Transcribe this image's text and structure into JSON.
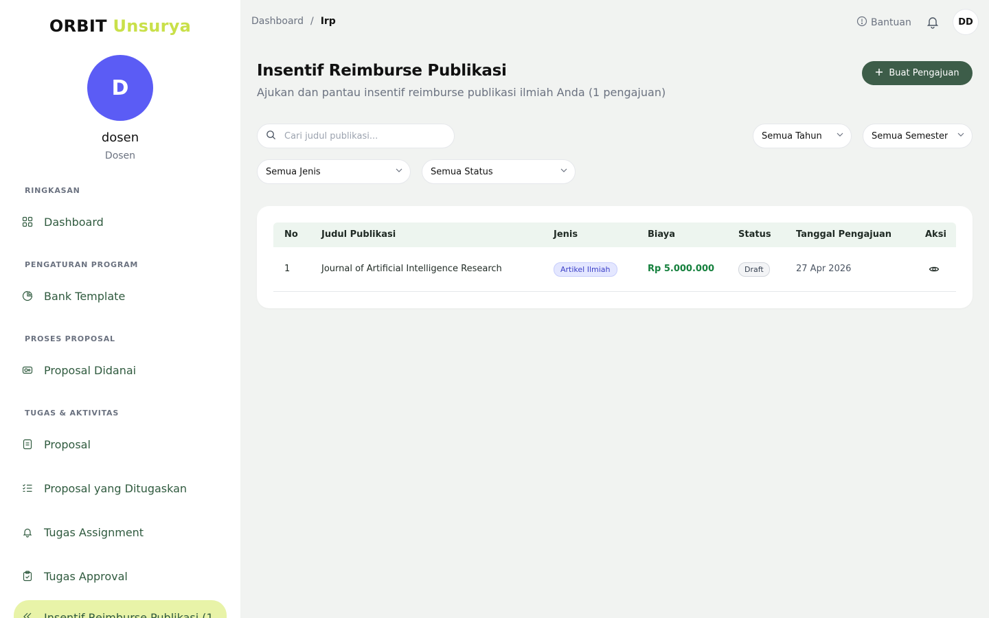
{
  "sidebar": {
    "brand_primary": "ORBIT",
    "brand_secondary": "Unsurya",
    "avatar_letter": "D",
    "user_name": "dosen",
    "user_role": "Dosen",
    "sections": {
      "ringkasan": "RINGKASAN",
      "pengaturan": "PENGATURAN PROGRAM",
      "proses": "PROSES PROPOSAL",
      "tugas": "TUGAS & AKTIVITAS"
    },
    "items": {
      "dashboard": "Dashboard",
      "bank_template": "Bank Template",
      "proposal_didanai": "Proposal Didanai",
      "proposal": "Proposal",
      "proposal_ditugaskan": "Proposal yang Ditugaskan",
      "tugas_assignment": "Tugas Assignment",
      "tugas_approval": "Tugas Approval",
      "insentif": "Insentif Reimburse Publikasi (1"
    }
  },
  "topbar": {
    "breadcrumb_root": "Dashboard",
    "breadcrumb_sep": "/",
    "breadcrumb_current": "Irp",
    "help_label": "Bantuan",
    "user_initials": "DD"
  },
  "header": {
    "title": "Insentif Reimburse Publikasi",
    "subtitle": "Ajukan dan pantau insentif reimburse publikasi ilmiah Anda (1 pengajuan)",
    "create_button": "Buat Pengajuan"
  },
  "filters": {
    "search_placeholder": "Cari judul publikasi...",
    "tahun": "Semua Tahun",
    "semester": "Semua Semester",
    "jenis": "Semua Jenis",
    "status": "Semua Status"
  },
  "table": {
    "headers": {
      "no": "No",
      "judul": "Judul Publikasi",
      "jenis": "Jenis",
      "biaya": "Biaya",
      "status": "Status",
      "tanggal": "Tanggal Pengajuan",
      "aksi": "Aksi"
    },
    "rows": [
      {
        "no": "1",
        "judul": "Journal of Artificial Intelligence Research",
        "jenis": "Artikel Ilmiah",
        "biaya": "Rp 5.000.000",
        "status": "Draft",
        "tanggal": "27 Apr 2026"
      }
    ]
  },
  "colors": {
    "brand_accent": "#c9e04a",
    "primary_button": "#3d5d49",
    "avatar": "#5b5cf5",
    "active_nav": "#e8f3a8",
    "money": "#15803d"
  },
  "icons": {
    "dashboard": "grid-icon",
    "bank_template": "pie-icon",
    "proposal_didanai": "money-icon",
    "proposal": "document-icon",
    "proposal_ditugaskan": "checklist-icon",
    "tugas_assignment": "bell-icon",
    "tugas_approval": "clipboard-check-icon",
    "insentif": "chevrons-icon"
  }
}
